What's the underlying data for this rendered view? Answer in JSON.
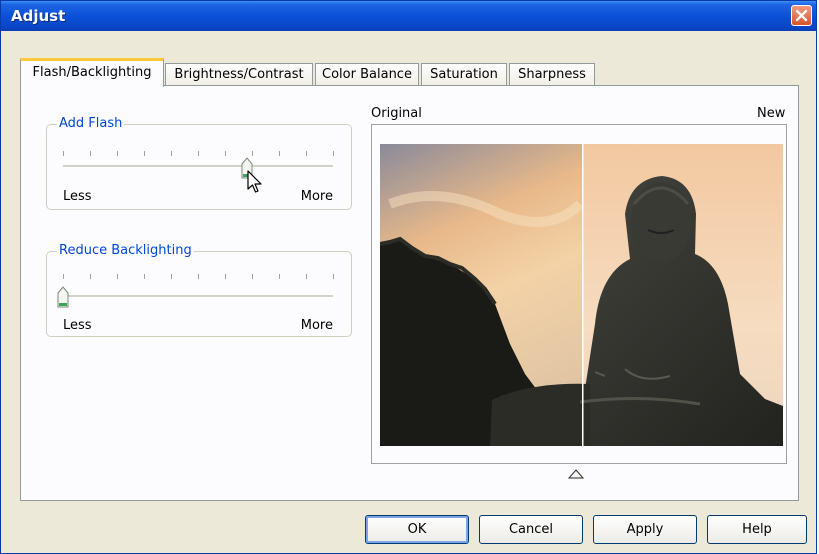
{
  "window": {
    "title": "Adjust"
  },
  "tabs": [
    {
      "label": "Flash/Backlighting",
      "active": true
    },
    {
      "label": "Brightness/Contrast",
      "active": false
    },
    {
      "label": "Color Balance",
      "active": false
    },
    {
      "label": "Saturation",
      "active": false
    },
    {
      "label": "Sharpness",
      "active": false
    }
  ],
  "add_flash": {
    "title": "Add Flash",
    "min_label": "Less",
    "max_label": "More",
    "value_fraction": 0.68
  },
  "reduce_backlighting": {
    "title": "Reduce Backlighting",
    "min_label": "Less",
    "max_label": "More",
    "value_fraction": 0.0
  },
  "preview": {
    "left_label": "Original",
    "right_label": "New"
  },
  "buttons": {
    "ok": "OK",
    "cancel": "Cancel",
    "apply": "Apply",
    "help": "Help"
  },
  "colors": {
    "titlebar": "#0b50d8",
    "group_title": "#0046d5",
    "tab_highlight": "#ffc83c",
    "close": "#d8542e"
  }
}
